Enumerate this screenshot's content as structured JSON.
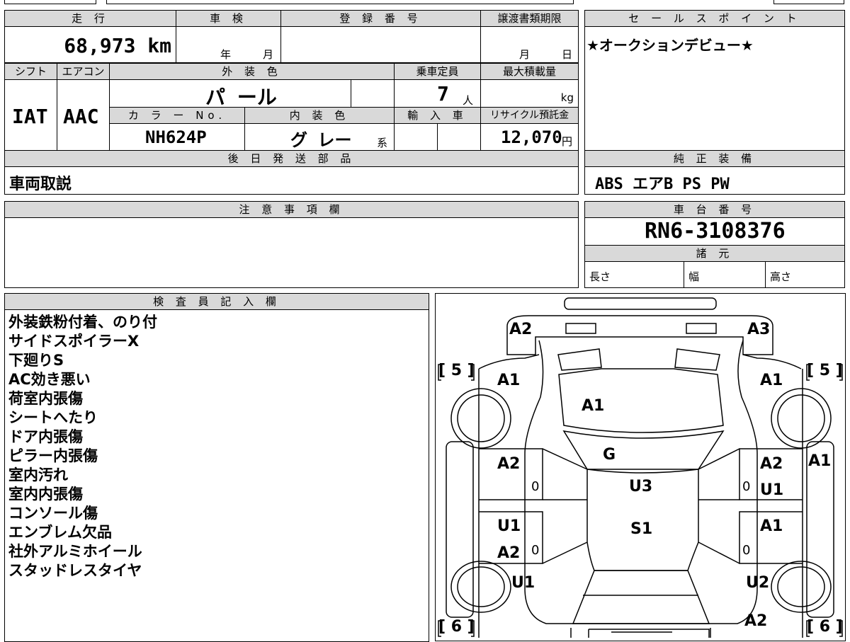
{
  "spec": {
    "h_mileage": "走 行",
    "h_inspection": "車 検",
    "h_registration": "登 録 番 号",
    "h_transfer_deadline": "譲渡書類期限",
    "mileage": "68,973 km",
    "insp_year": "年",
    "insp_month": "月",
    "deadline_month": "月",
    "deadline_day": "日",
    "h_shift": "シフト",
    "h_aircon": "エアコン",
    "h_exterior_color": "外 装 色",
    "h_capacity": "乗車定員",
    "h_max_load": "最大積載量",
    "shift": "IAT",
    "aircon": "AAC",
    "exterior_color": "パ ール",
    "capacity": "7",
    "capacity_unit": "人",
    "load_unit": "kg",
    "h_color_no": "カ ラ ー No.",
    "h_interior_color": "内 装 色",
    "h_import": "輸 入 車",
    "h_recycle": "リサイクル預託金",
    "color_no": "NH624P",
    "interior_color": "グ レー",
    "interior_suffix": "系",
    "recycle": "12,070",
    "recycle_unit": "円",
    "h_later_parts": "後 日 発 送 部 品",
    "later_parts": "車両取説"
  },
  "sales": {
    "header": "セ ー ル ス ポ イ ン ト",
    "text": "★オークションデビュー★"
  },
  "equipment": {
    "header": "純 正 装 備",
    "text": "ABS エアB PS PW"
  },
  "caution": {
    "header": "注 意 事 項 欄"
  },
  "chassis": {
    "header": "車 台 番 号",
    "number": "RN6-3108376",
    "dims_header": "諸 元",
    "length": "長さ",
    "width": "幅",
    "height": "高さ"
  },
  "inspector": {
    "header": "検 査 員 記 入 欄",
    "notes": [
      "外装鉄粉付着、のり付",
      "サイドスポイラーX",
      "下廻りS",
      "AC効き悪い",
      "荷室内張傷",
      "シートへたり",
      "ドア内張傷",
      "ピラー内張傷",
      "室内汚れ",
      "室内内張傷",
      "コンソール傷",
      "エンブレム欠品",
      "社外アルミホイール",
      "スタッドレスタイヤ"
    ]
  },
  "diagram": {
    "marks": {
      "a2_top_left": "A2",
      "a3_top_right": "A3",
      "a1_tailgate": "A1",
      "a1_rear_left": "A1",
      "a1_rear_right": "A1",
      "g_glass": "G",
      "u3_roof": "U3",
      "s1_roof": "S1",
      "a2_left_rear_door": "A2",
      "a2_right_rear_door": "A2",
      "u1_right_rear_door": "U1",
      "a1_right_side": "A1",
      "u1_left_front_door": "U1",
      "a2_left_front_door": "A2",
      "a1_right_front_door": "A1",
      "u1_left_front": "U1",
      "u2_right_front": "U2",
      "a2_front_right": "A2"
    },
    "tire_rear_left": "[ 5 ]",
    "tire_rear_right": "[ 5 ]",
    "tire_front_left": "[ 6 ]",
    "tire_front_right": "[ 6 ]",
    "zero_marks": [
      "0",
      "0",
      "0",
      "0"
    ]
  }
}
